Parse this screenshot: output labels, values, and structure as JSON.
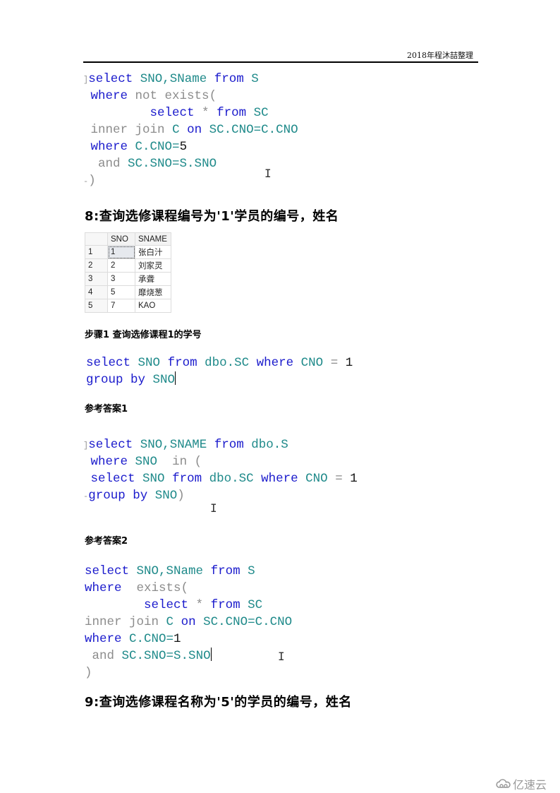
{
  "header": {
    "text": "2018年程沐喆整理"
  },
  "code_block_1": {
    "lines": [
      [
        [
          "mark",
          "]"
        ],
        [
          "kw",
          "select"
        ],
        [
          "sp",
          " "
        ],
        [
          "id",
          "SNO,SName"
        ],
        [
          "sp",
          " "
        ],
        [
          "kw",
          "from"
        ],
        [
          "sp",
          " "
        ],
        [
          "id",
          "S"
        ]
      ],
      [
        [
          "sp",
          " "
        ],
        [
          "kw",
          "where"
        ],
        [
          "sp",
          " "
        ],
        [
          "gr",
          "not exists("
        ]
      ],
      [
        [
          "sp",
          "         "
        ],
        [
          "kw",
          "select"
        ],
        [
          "sp",
          " "
        ],
        [
          "gr",
          "*"
        ],
        [
          "sp",
          " "
        ],
        [
          "kw",
          "from"
        ],
        [
          "sp",
          " "
        ],
        [
          "id",
          "SC"
        ]
      ],
      [
        [
          "sp",
          " "
        ],
        [
          "gr",
          "inner join"
        ],
        [
          "sp",
          " "
        ],
        [
          "id",
          "C"
        ],
        [
          "sp",
          " "
        ],
        [
          "kw",
          "on"
        ],
        [
          "sp",
          " "
        ],
        [
          "id",
          "SC.CNO=C.CNO"
        ]
      ],
      [
        [
          "sp",
          " "
        ],
        [
          "kw",
          "where"
        ],
        [
          "sp",
          " "
        ],
        [
          "id",
          "C.CNO="
        ],
        [
          "bk",
          "5"
        ]
      ],
      [
        [
          "sp",
          "  "
        ],
        [
          "gr",
          "and"
        ],
        [
          "sp",
          " "
        ],
        [
          "id",
          "SC.SNO=S.SNO"
        ]
      ],
      [
        [
          "mark",
          "-"
        ],
        [
          "gr",
          ")"
        ]
      ]
    ]
  },
  "question_8": {
    "title": "8:查询选修课程编号为'1'学员的编号，姓名"
  },
  "result_grid": {
    "columns": [
      "",
      "SNO",
      "SNAME"
    ],
    "rows": [
      [
        "1",
        "1",
        "张白汁"
      ],
      [
        "2",
        "2",
        "刘家灵"
      ],
      [
        "3",
        "3",
        "承聋"
      ],
      [
        "4",
        "5",
        "靡烧葱"
      ],
      [
        "5",
        "7",
        "KAO"
      ]
    ]
  },
  "step_1": {
    "title": "步骤1 查询选修课程1的学号"
  },
  "code_block_2": {
    "lines": [
      [
        [
          "kw",
          "select"
        ],
        [
          "sp",
          " "
        ],
        [
          "id",
          "SNO"
        ],
        [
          "sp",
          " "
        ],
        [
          "kw",
          "from"
        ],
        [
          "sp",
          " "
        ],
        [
          "id",
          "dbo.SC"
        ],
        [
          "sp",
          " "
        ],
        [
          "kw",
          "where"
        ],
        [
          "sp",
          " "
        ],
        [
          "id",
          "CNO"
        ],
        [
          "sp",
          " "
        ],
        [
          "gr",
          "="
        ],
        [
          "sp",
          " "
        ],
        [
          "bk",
          "1"
        ]
      ],
      [
        [
          "kw",
          "group by"
        ],
        [
          "sp",
          " "
        ],
        [
          "id",
          "SNO"
        ],
        [
          "caret",
          ""
        ]
      ]
    ]
  },
  "answer_1": {
    "title": "参考答案1"
  },
  "code_block_3": {
    "lines": [
      [
        [
          "mark",
          "]"
        ],
        [
          "kw",
          "select"
        ],
        [
          "sp",
          " "
        ],
        [
          "id",
          "SNO,SNAME"
        ],
        [
          "sp",
          " "
        ],
        [
          "kw",
          "from"
        ],
        [
          "sp",
          " "
        ],
        [
          "id",
          "dbo.S"
        ]
      ],
      [
        [
          "sp",
          " "
        ],
        [
          "kw",
          "where"
        ],
        [
          "sp",
          " "
        ],
        [
          "id",
          "SNO"
        ],
        [
          "sp",
          "  "
        ],
        [
          "gr",
          "in ("
        ]
      ],
      [
        [
          "sp",
          " "
        ],
        [
          "kw",
          "select"
        ],
        [
          "sp",
          " "
        ],
        [
          "id",
          "SNO"
        ],
        [
          "sp",
          " "
        ],
        [
          "kw",
          "from"
        ],
        [
          "sp",
          " "
        ],
        [
          "id",
          "dbo.SC"
        ],
        [
          "sp",
          " "
        ],
        [
          "kw",
          "where"
        ],
        [
          "sp",
          " "
        ],
        [
          "id",
          "CNO"
        ],
        [
          "sp",
          " "
        ],
        [
          "gr",
          "="
        ],
        [
          "sp",
          " "
        ],
        [
          "bk",
          "1"
        ]
      ],
      [
        [
          "mark",
          "-"
        ],
        [
          "kw",
          "group by"
        ],
        [
          "sp",
          " "
        ],
        [
          "id",
          "SNO"
        ],
        [
          "gr",
          ")"
        ]
      ]
    ]
  },
  "answer_2": {
    "title": "参考答案2"
  },
  "code_block_4": {
    "lines": [
      [
        [
          "kw",
          "select"
        ],
        [
          "sp",
          " "
        ],
        [
          "id",
          "SNO,SName"
        ],
        [
          "sp",
          " "
        ],
        [
          "kw",
          "from"
        ],
        [
          "sp",
          " "
        ],
        [
          "id",
          "S"
        ]
      ],
      [
        [
          "kw",
          "where"
        ],
        [
          "sp",
          "  "
        ],
        [
          "gr",
          "exists("
        ]
      ],
      [
        [
          "sp",
          "        "
        ],
        [
          "kw",
          "select"
        ],
        [
          "sp",
          " "
        ],
        [
          "gr",
          "*"
        ],
        [
          "sp",
          " "
        ],
        [
          "kw",
          "from"
        ],
        [
          "sp",
          " "
        ],
        [
          "id",
          "SC"
        ]
      ],
      [
        [
          "gr",
          "inner join"
        ],
        [
          "sp",
          " "
        ],
        [
          "id",
          "C"
        ],
        [
          "sp",
          " "
        ],
        [
          "kw",
          "on"
        ],
        [
          "sp",
          " "
        ],
        [
          "id",
          "SC.CNO=C.CNO"
        ]
      ],
      [
        [
          "kw",
          "where"
        ],
        [
          "sp",
          " "
        ],
        [
          "id",
          "C.CNO="
        ],
        [
          "bk",
          "1"
        ]
      ],
      [
        [
          "sp",
          " "
        ],
        [
          "gr",
          "and"
        ],
        [
          "sp",
          " "
        ],
        [
          "id",
          "SC.SNO=S.SNO"
        ],
        [
          "caret",
          ""
        ]
      ],
      [
        [
          "gr",
          ")"
        ]
      ]
    ]
  },
  "question_9": {
    "title": "9:查询选修课程名称为'5'的学员的编号，姓名"
  },
  "watermark": {
    "text": "亿速云",
    "icon": "cloud-logo-icon"
  },
  "cursor": {
    "glyph": "I"
  }
}
